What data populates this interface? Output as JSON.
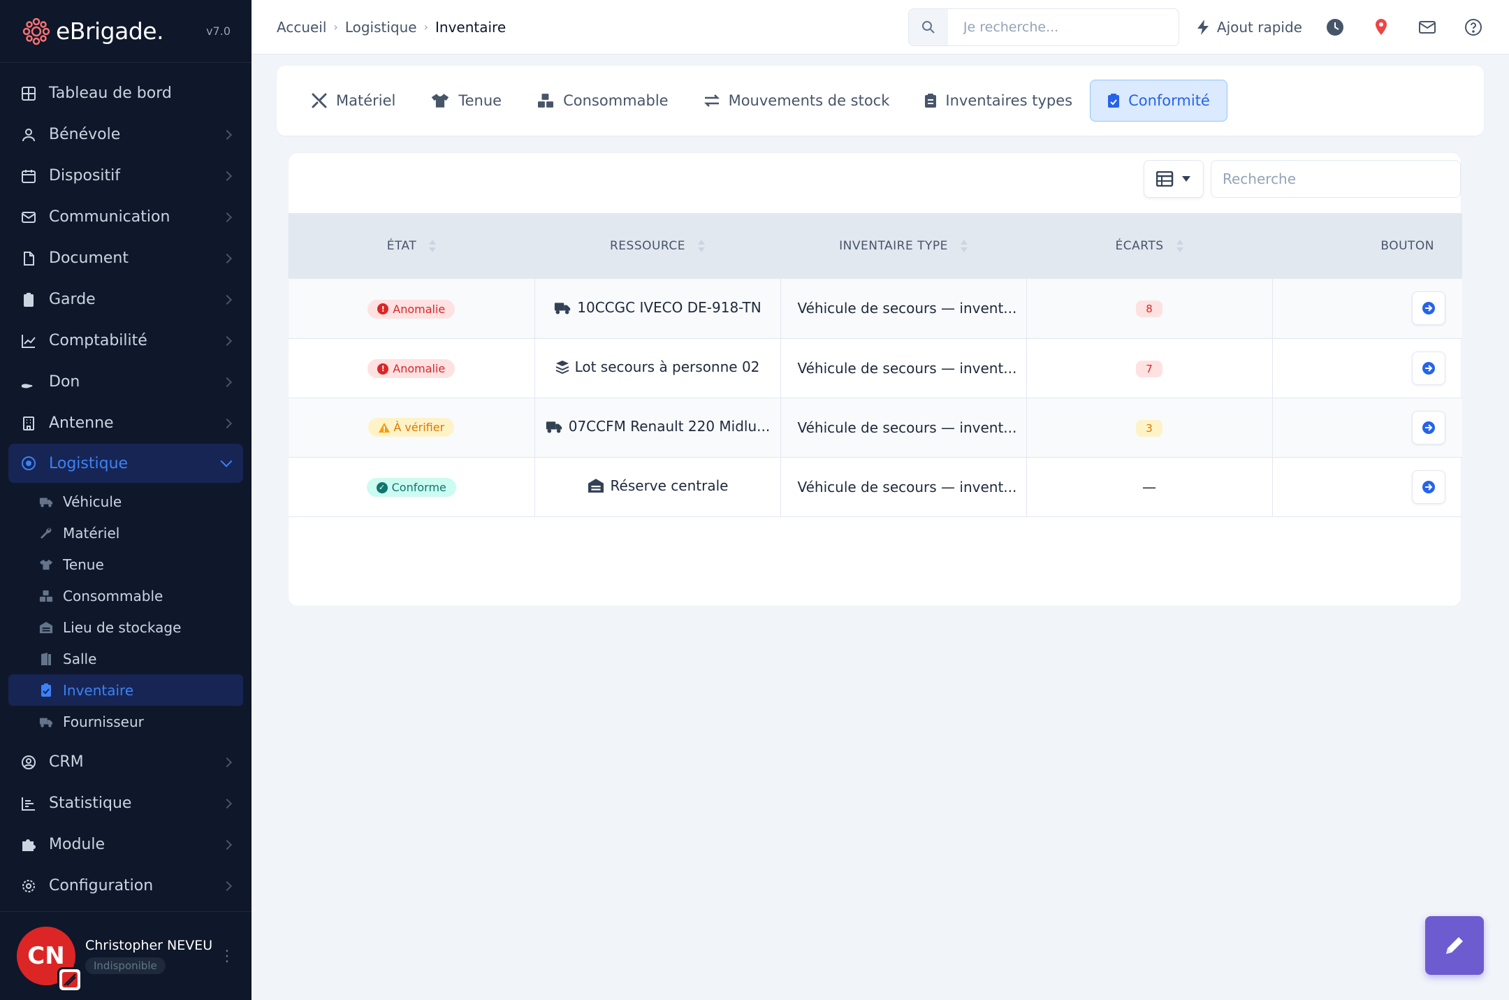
{
  "brand": {
    "name": "eBrigade.",
    "version": "v7.0"
  },
  "sidebar": {
    "items": [
      {
        "label": "Tableau de bord",
        "icon": "dashboard-icon"
      },
      {
        "label": "Bénévole",
        "icon": "user-icon"
      },
      {
        "label": "Dispositif",
        "icon": "calendar-icon"
      },
      {
        "label": "Communication",
        "icon": "mail-icon"
      },
      {
        "label": "Document",
        "icon": "file-icon"
      },
      {
        "label": "Garde",
        "icon": "clipboard-icon"
      },
      {
        "label": "Comptabilité",
        "icon": "chart-icon"
      },
      {
        "label": "Don",
        "icon": "hand-icon"
      },
      {
        "label": "Antenne",
        "icon": "building-icon"
      },
      {
        "label": "Logistique",
        "icon": "target-icon"
      },
      {
        "label": "CRM",
        "icon": "contact-icon"
      },
      {
        "label": "Statistique",
        "icon": "stats-icon"
      },
      {
        "label": "Module",
        "icon": "puzzle-icon"
      },
      {
        "label": "Configuration",
        "icon": "gear-icon"
      }
    ],
    "logistique_sub": [
      {
        "label": "Véhicule",
        "icon": "truck-icon"
      },
      {
        "label": "Matériel",
        "icon": "wrench-icon"
      },
      {
        "label": "Tenue",
        "icon": "shirt-icon"
      },
      {
        "label": "Consommable",
        "icon": "boxes-icon"
      },
      {
        "label": "Lieu de stockage",
        "icon": "warehouse-icon"
      },
      {
        "label": "Salle",
        "icon": "door-icon"
      },
      {
        "label": "Inventaire",
        "icon": "clipboard-check-icon"
      },
      {
        "label": "Fournisseur",
        "icon": "truck-icon"
      }
    ]
  },
  "user": {
    "initials": "CN",
    "name": "Christopher NEVEU",
    "status": "Indisponible"
  },
  "breadcrumb": {
    "home": "Accueil",
    "section": "Logistique",
    "current": "Inventaire",
    "sep": "›"
  },
  "topbar": {
    "search_placeholder": "Je recherche...",
    "quick_add": "Ajout rapide"
  },
  "tabs": [
    {
      "label": "Matériel"
    },
    {
      "label": "Tenue"
    },
    {
      "label": "Consommable"
    },
    {
      "label": "Mouvements de stock"
    },
    {
      "label": "Inventaires types"
    },
    {
      "label": "Conformité"
    }
  ],
  "table": {
    "search_placeholder": "Recherche",
    "headers": [
      "ÉTAT",
      "RESSOURCE",
      "INVENTAIRE TYPE",
      "ÉCARTS",
      "BOUTON"
    ],
    "rows": [
      {
        "etat": "Anomalie",
        "ressource": "10CCGC IVECO DE-918-TN",
        "inventaire": "Véhicule de secours — invent...",
        "ecarts": "8"
      },
      {
        "etat": "Anomalie",
        "ressource": "Lot secours à personne 02",
        "inventaire": "Véhicule de secours — invent...",
        "ecarts": "7"
      },
      {
        "etat": "À vérifier",
        "ressource": "07CCFM Renault 220 Midlu...",
        "inventaire": "Véhicule de secours — invent...",
        "ecarts": "3"
      },
      {
        "etat": "Conforme",
        "ressource": "Réserve centrale",
        "inventaire": "Véhicule de secours — invent...",
        "ecarts": "—"
      }
    ]
  },
  "colors": {
    "accent": "#2563eb",
    "sidebar_bg": "#0f172a",
    "danger": "#dc2626",
    "warning": "#d97706",
    "success": "#0f766e"
  }
}
